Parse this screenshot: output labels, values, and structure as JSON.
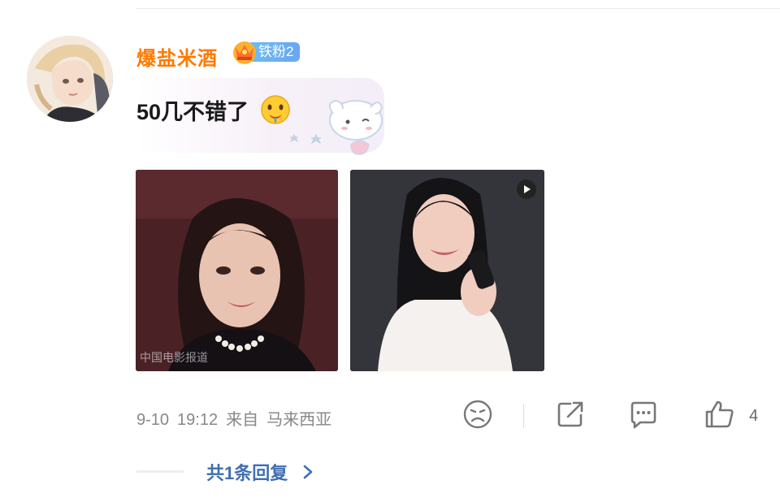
{
  "comment": {
    "username": "爆盐米酒",
    "fan_badge": "铁粉2",
    "text": "50几不错了",
    "emoji": "drooling-face-emoji"
  },
  "images": {
    "photo1_watermark": "中国电影报道",
    "photo2_type": "video"
  },
  "meta": {
    "date": "9-10",
    "time": "19:12",
    "source_prefix": "来自",
    "location": "马来西亚"
  },
  "actions": {
    "like_count": "4",
    "icons": [
      "frown-icon",
      "share-icon",
      "comment-icon",
      "thumbs-up-icon"
    ]
  },
  "replies": {
    "label": "共1条回复"
  },
  "colors": {
    "username": "#ff7a00",
    "badge": "#6aaef4",
    "reply_link": "#3f6eb2",
    "meta_text": "#888888"
  }
}
